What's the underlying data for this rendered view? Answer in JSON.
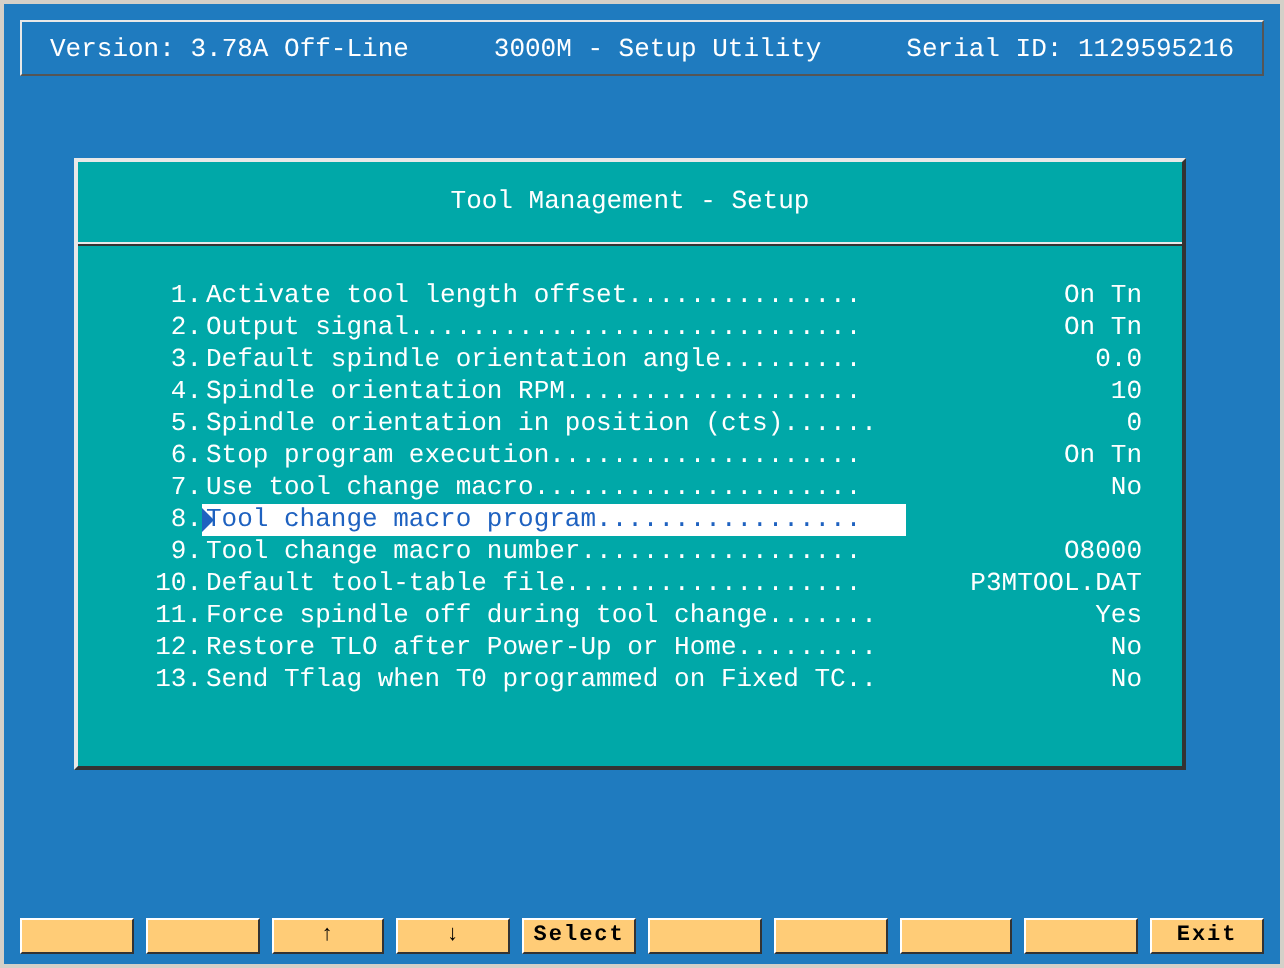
{
  "header": {
    "version": "Version: 3.78A Off-Line",
    "title": "3000M - Setup Utility",
    "serial": "Serial ID: 1129595216"
  },
  "dialog": {
    "title": "Tool Management - Setup",
    "items": [
      {
        "number": "1.",
        "label": "Activate tool length offset...............",
        "value": "On Tn",
        "selected": false
      },
      {
        "number": "2.",
        "label": "Output signal.............................",
        "value": "On Tn",
        "selected": false
      },
      {
        "number": "3.",
        "label": "Default spindle orientation angle.........",
        "value": "0.0",
        "selected": false
      },
      {
        "number": "4.",
        "label": "Spindle orientation RPM...................",
        "value": "10",
        "selected": false
      },
      {
        "number": "5.",
        "label": "Spindle orientation in position (cts)......",
        "value": "0",
        "selected": false
      },
      {
        "number": "6.",
        "label": "Stop program execution....................",
        "value": "On Tn",
        "selected": false
      },
      {
        "number": "7.",
        "label": "Use tool change macro.....................",
        "value": "No",
        "selected": false
      },
      {
        "number": "8.",
        "label": "Tool change macro program.................",
        "selected": true
      },
      {
        "number": "9.",
        "label": "Tool change macro number..................",
        "value": "O8000",
        "selected": false
      },
      {
        "number": "10.",
        "label": "Default tool-table file...................",
        "value": "P3MTOOL.DAT",
        "selected": false
      },
      {
        "number": "11.",
        "label": "Force spindle off during tool change.......",
        "value": "Yes",
        "selected": false
      },
      {
        "number": "12.",
        "label": "Restore TLO after Power-Up or Home.........",
        "value": "No",
        "selected": false
      },
      {
        "number": "13.",
        "label": "Send Tflag when T0 programmed on Fixed TC..",
        "value": "No",
        "selected": false
      }
    ]
  },
  "function_keys": [
    {
      "kind": "blank"
    },
    {
      "kind": "blank"
    },
    {
      "kind": "text",
      "label": "↑"
    },
    {
      "kind": "text",
      "label": "↓"
    },
    {
      "kind": "text",
      "label": "Select"
    },
    {
      "kind": "blank"
    },
    {
      "kind": "blank"
    },
    {
      "kind": "blank"
    },
    {
      "kind": "blank"
    },
    {
      "kind": "text",
      "label": "Exit"
    }
  ]
}
